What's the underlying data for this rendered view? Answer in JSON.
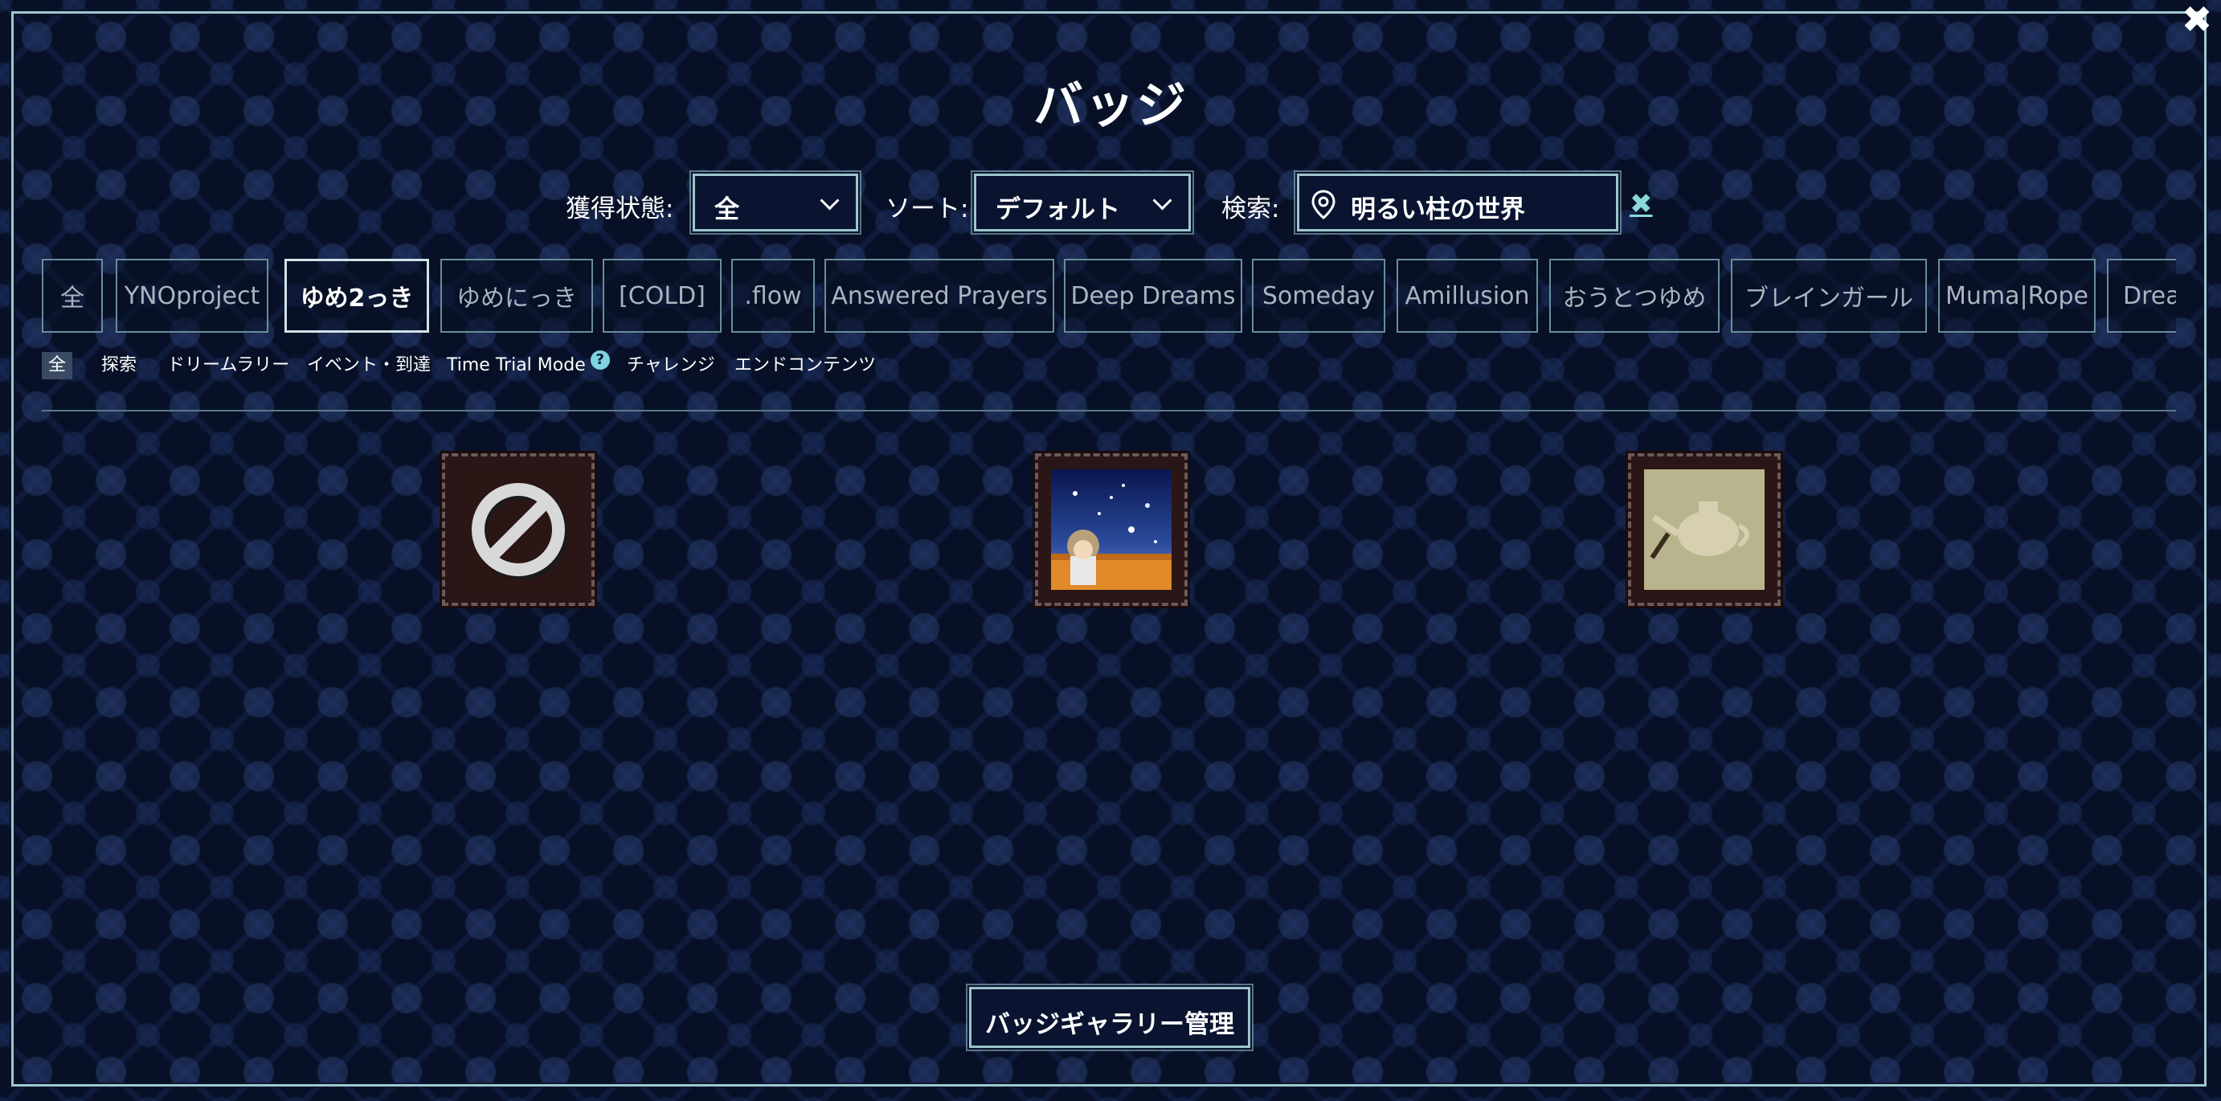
{
  "modal": {
    "title": "バッジ",
    "close_icon": "close-icon"
  },
  "filters": {
    "obtained_label": "獲得状態:",
    "obtained_value": "全",
    "sort_label": "ソート:",
    "sort_value": "デフォルト",
    "search_label": "検索:",
    "search_value": "明るい柱の世界",
    "search_icon": "map-pin-icon",
    "clear_label": "✖"
  },
  "game_tabs": [
    {
      "label": "全"
    },
    {
      "label": "YNOproject"
    },
    {
      "label": "ゆめ2っき",
      "active": true
    },
    {
      "label": "ゆめにっき"
    },
    {
      "label": "[COLD]"
    },
    {
      "label": ".flow"
    },
    {
      "label": "Answered Prayers"
    },
    {
      "label": "Deep Dreams"
    },
    {
      "label": "Someday"
    },
    {
      "label": "Amillusion"
    },
    {
      "label": "おうとつゆめ"
    },
    {
      "label": "ブレインガール"
    },
    {
      "label": "Muma|Rope"
    },
    {
      "label": "Dream"
    }
  ],
  "subcategories": [
    {
      "label": "全",
      "active": true
    },
    {
      "label": "探索"
    },
    {
      "label": "ドリームラリー"
    },
    {
      "label": "イベント・到達"
    },
    {
      "label": "Time Trial Mode",
      "help": "?"
    },
    {
      "label": "チャレンジ"
    },
    {
      "label": "エンドコンテンツ"
    }
  ],
  "badges": [
    {
      "icon": "null-badge-icon"
    },
    {
      "icon": "starry-night-girl-badge-icon"
    },
    {
      "icon": "teapot-badge-icon"
    }
  ],
  "footer": {
    "gallery_button": "バッジギャラリー管理"
  },
  "colors": {
    "accent": "#9cc6cc",
    "background": "#071026",
    "clear": "#8ad8d8"
  }
}
